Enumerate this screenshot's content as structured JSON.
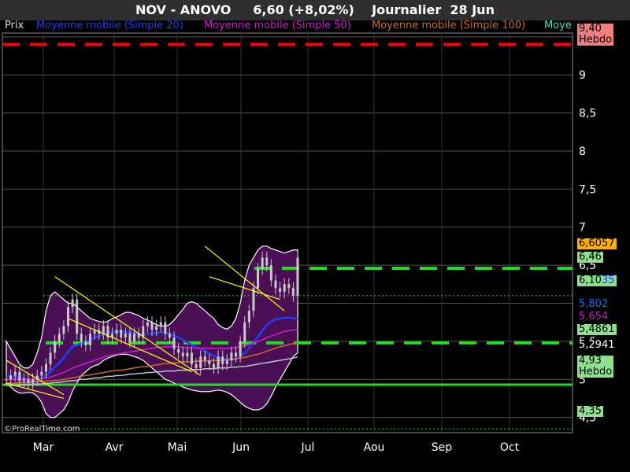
{
  "header": {
    "title": "NOV - ANOVO     6,60 (+8,02%)    Journalier  28 Jun"
  },
  "legend": {
    "prix": "Prix",
    "ma20": "Moyenne mobile (Simple 20)",
    "ma50": "Moyenne mobile (Simple 50)",
    "ma100": "Moyenne mobile (Simple 100)",
    "cut": "Moye"
  },
  "colors": {
    "background": "#000000",
    "bollinger_fill": "#4b0f55",
    "candles": "#c8c8c8",
    "ma20": "#1f3cff",
    "ma50": "#d21ed2",
    "ma100": "#d2691e",
    "ma_extra": "#b4c8c8",
    "green_line": "#22dd22",
    "red_line": "#ff0000",
    "trend": "#ffff00"
  },
  "watermark": "©ProRealTime.com",
  "price_tags": [
    {
      "text_a": "9,40",
      "text_b": "Hebdo",
      "bg": "#f08080",
      "color": "#000"
    },
    {
      "text_a": "6,60",
      "text_b": "57",
      "bg": "#ffb000",
      "color": "#000"
    },
    {
      "text_a": "6,46",
      "text_b": "",
      "bg": "#8ee08e",
      "color": "#000"
    },
    {
      "text_a": "6,10",
      "text_b": "35",
      "bg": "#8ee08e",
      "color": "#000",
      "color_b": "#1f3cff"
    },
    {
      "text_a": "5,802",
      "text_b": "",
      "bg": "#000",
      "color": "#1f6cff"
    },
    {
      "text_a": "5,654",
      "text_b": "",
      "bg": "#000",
      "color": "#d21ed2"
    },
    {
      "text_a": "5,48",
      "text_b": "61",
      "bg": "#8ee08e",
      "color": "#000"
    },
    {
      "text_a": "5,2941",
      "text_b": "",
      "bg": "#000",
      "color": "#ffffff"
    },
    {
      "text_a": "4,93",
      "text_b": "Hebdo",
      "bg": "#8ee08e",
      "color": "#000"
    },
    {
      "text_a": "4,35",
      "text_b": "",
      "bg": "#8ee08e",
      "color": "#000"
    }
  ],
  "chart_data": {
    "type": "candlestick",
    "title": "NOV - ANOVO     6,60 (+8,02%)    Journalier  28 Jun",
    "x_tick_labels": [
      "Mar",
      "Avr",
      "Mai",
      "Jun",
      "Jul",
      "Aou",
      "Sep",
      "Oct"
    ],
    "y_tick_labels": [
      "4,5",
      "5",
      "5,5",
      "6",
      "6,5",
      "7",
      "7,5",
      "8",
      "8,5",
      "9",
      "9,5"
    ],
    "y_ticks": [
      4.5,
      5,
      5.5,
      6,
      6.5,
      7,
      7.5,
      8,
      8.5,
      9,
      9.5
    ],
    "ylim": [
      4.3,
      9.55
    ],
    "last_price": 6.6,
    "series": [
      {
        "name": "Prix",
        "close": [
          5.0,
          5.05,
          5.1,
          4.98,
          5.0,
          4.95,
          5.0,
          5.05,
          5.1,
          5.2,
          5.35,
          5.5,
          5.6,
          5.7,
          5.95,
          6.05,
          5.6,
          5.5,
          5.45,
          5.6,
          5.65,
          5.6,
          5.7,
          5.55,
          5.6,
          5.65,
          5.55,
          5.6,
          5.5,
          5.6,
          5.55,
          5.7,
          5.75,
          5.65,
          5.7,
          5.75,
          5.6,
          5.55,
          5.4,
          5.35,
          5.3,
          5.35,
          5.2,
          5.15,
          5.3,
          5.25,
          5.2,
          5.15,
          5.3,
          5.2,
          5.25,
          5.35,
          5.3,
          5.5,
          5.75,
          5.9,
          6.2,
          6.45,
          6.6,
          6.5,
          6.3,
          6.2,
          6.15,
          6.25,
          6.2,
          6.1,
          6.6
        ]
      },
      {
        "name": "Moyenne mobile (Simple 20)",
        "values": [
          5.05,
          5.04,
          5.04,
          5.02,
          5.01,
          5.0,
          4.99,
          5.0,
          5.02,
          5.05,
          5.1,
          5.16,
          5.22,
          5.28,
          5.36,
          5.43,
          5.45,
          5.47,
          5.49,
          5.52,
          5.55,
          5.57,
          5.59,
          5.61,
          5.62,
          5.63,
          5.63,
          5.62,
          5.61,
          5.61,
          5.6,
          5.6,
          5.6,
          5.6,
          5.61,
          5.62,
          5.61,
          5.6,
          5.58,
          5.55,
          5.52,
          5.49,
          5.45,
          5.42,
          5.4,
          5.37,
          5.34,
          5.31,
          5.29,
          5.27,
          5.26,
          5.26,
          5.27,
          5.3,
          5.35,
          5.41,
          5.48,
          5.56,
          5.64,
          5.71,
          5.76,
          5.79,
          5.8,
          5.81,
          5.81,
          5.8,
          5.802
        ]
      },
      {
        "name": "Moyenne mobile (Simple 50)",
        "values": [
          5.0,
          5.0,
          5.0,
          5.0,
          5.0,
          5.0,
          5.0,
          5.0,
          5.01,
          5.02,
          5.03,
          5.05,
          5.07,
          5.09,
          5.12,
          5.15,
          5.17,
          5.19,
          5.21,
          5.23,
          5.25,
          5.27,
          5.29,
          5.31,
          5.32,
          5.33,
          5.34,
          5.35,
          5.36,
          5.37,
          5.38,
          5.39,
          5.4,
          5.41,
          5.42,
          5.42,
          5.43,
          5.43,
          5.43,
          5.43,
          5.42,
          5.42,
          5.41,
          5.41,
          5.41,
          5.41,
          5.41,
          5.41,
          5.41,
          5.41,
          5.41,
          5.41,
          5.42,
          5.43,
          5.44,
          5.46,
          5.48,
          5.5,
          5.52,
          5.55,
          5.57,
          5.59,
          5.61,
          5.63,
          5.64,
          5.65,
          5.654
        ]
      },
      {
        "name": "Moyenne mobile (Simple 100)",
        "values": [
          4.95,
          4.95,
          4.95,
          4.96,
          4.96,
          4.96,
          4.97,
          4.97,
          4.97,
          4.98,
          4.98,
          4.99,
          4.99,
          5.0,
          5.01,
          5.02,
          5.03,
          5.04,
          5.05,
          5.06,
          5.07,
          5.08,
          5.09,
          5.1,
          5.11,
          5.12,
          5.12,
          5.13,
          5.14,
          5.15,
          5.16,
          5.17,
          5.17,
          5.18,
          5.19,
          5.2,
          5.21,
          5.21,
          5.22,
          5.22,
          5.23,
          5.23,
          5.23,
          5.24,
          5.24,
          5.24,
          5.24,
          5.25,
          5.25,
          5.25,
          5.26,
          5.26,
          5.27,
          5.28,
          5.29,
          5.3,
          5.32,
          5.33,
          5.35,
          5.37,
          5.39,
          5.41,
          5.43,
          5.44,
          5.46,
          5.47,
          5.48
        ]
      },
      {
        "name": "Moye",
        "values": [
          4.92,
          4.92,
          4.92,
          4.93,
          4.93,
          4.93,
          4.94,
          4.94,
          4.94,
          4.95,
          4.95,
          4.96,
          4.96,
          4.97,
          4.98,
          4.98,
          4.99,
          5.0,
          5.0,
          5.01,
          5.02,
          5.02,
          5.03,
          5.04,
          5.04,
          5.05,
          5.05,
          5.06,
          5.07,
          5.07,
          5.08,
          5.08,
          5.09,
          5.09,
          5.1,
          5.1,
          5.11,
          5.11,
          5.11,
          5.12,
          5.12,
          5.12,
          5.13,
          5.13,
          5.13,
          5.14,
          5.14,
          5.14,
          5.15,
          5.15,
          5.15,
          5.16,
          5.16,
          5.17,
          5.17,
          5.18,
          5.19,
          5.2,
          5.21,
          5.22,
          5.23,
          5.24,
          5.25,
          5.26,
          5.27,
          5.28,
          5.2941
        ]
      }
    ],
    "bollinger_upper": [
      5.5,
      5.4,
      5.3,
      5.2,
      5.15,
      5.15,
      5.2,
      5.35,
      5.55,
      5.9,
      6.1,
      6.15,
      6.1,
      6.05,
      6.0,
      6.0,
      5.95,
      5.9,
      5.85,
      5.8,
      5.78,
      5.76,
      5.75,
      5.76,
      5.8,
      5.82,
      5.85,
      5.88,
      5.88,
      5.86,
      5.84,
      5.8,
      5.78,
      5.75,
      5.72,
      5.7,
      5.7,
      5.72,
      5.78,
      5.85,
      5.92,
      6.0,
      6.02,
      6.0,
      5.95,
      5.9,
      5.85,
      5.8,
      5.72,
      5.68,
      5.66,
      5.7,
      5.8,
      6.0,
      6.3,
      6.5,
      6.6,
      6.7,
      6.75,
      6.75,
      6.72,
      6.7,
      6.68,
      6.66,
      6.68,
      6.7,
      6.7
    ],
    "bollinger_lower": [
      4.95,
      4.9,
      4.85,
      4.82,
      4.82,
      4.83,
      4.82,
      4.78,
      4.7,
      4.55,
      4.5,
      4.5,
      4.55,
      4.6,
      4.7,
      4.85,
      4.95,
      5.05,
      5.1,
      5.15,
      5.18,
      5.2,
      5.25,
      5.28,
      5.3,
      5.32,
      5.33,
      5.33,
      5.32,
      5.3,
      5.28,
      5.25,
      5.2,
      5.15,
      5.1,
      5.05,
      5.0,
      4.98,
      4.95,
      4.93,
      4.9,
      4.88,
      4.86,
      4.85,
      4.84,
      4.84,
      4.84,
      4.85,
      4.86,
      4.85,
      4.83,
      4.8,
      4.75,
      4.7,
      4.65,
      4.62,
      4.6,
      4.6,
      4.62,
      4.68,
      4.78,
      4.9,
      5.0,
      5.1,
      5.2,
      5.3,
      5.35
    ],
    "horizontal_levels": [
      {
        "value": 9.4,
        "style": "dashed",
        "color": "red"
      },
      {
        "value": 6.46,
        "style": "dashed",
        "color": "green"
      },
      {
        "value": 6.1,
        "style": "dotted",
        "color": "green"
      },
      {
        "value": 5.48,
        "style": "dashed",
        "color": "green"
      },
      {
        "value": 4.93,
        "style": "solid",
        "color": "green"
      },
      {
        "value": 4.35,
        "style": "dotted",
        "color": "green"
      }
    ],
    "trend_lines": [
      {
        "x": [
          0,
          13
        ],
        "y": [
          5.25,
          4.8
        ]
      },
      {
        "x": [
          0,
          13
        ],
        "y": [
          4.95,
          4.75
        ]
      },
      {
        "x": [
          11,
          44
        ],
        "y": [
          6.35,
          5.05
        ]
      },
      {
        "x": [
          14,
          42
        ],
        "y": [
          5.8,
          5.1
        ]
      },
      {
        "x": [
          45,
          63
        ],
        "y": [
          6.75,
          5.9
        ]
      },
      {
        "x": [
          46,
          62
        ],
        "y": [
          6.35,
          6.05
        ]
      }
    ],
    "grid": true
  }
}
